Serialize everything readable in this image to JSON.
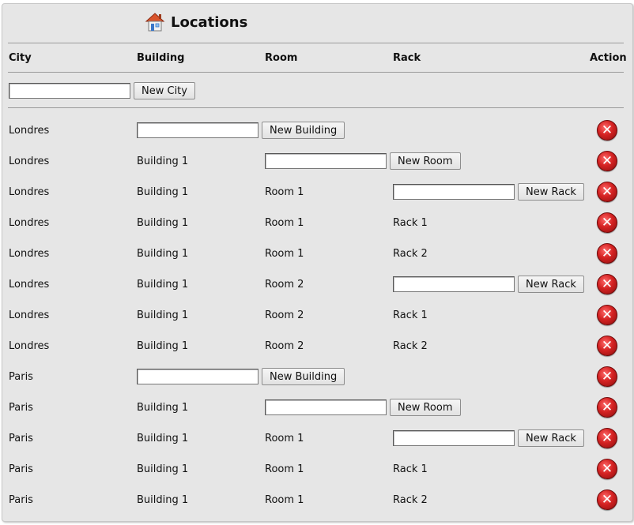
{
  "title": "Locations",
  "columns": {
    "city": "City",
    "building": "Building",
    "room": "Room",
    "rack": "Rack",
    "action": "Action"
  },
  "new_city_button": "New City",
  "delete_glyph": "✕",
  "rows": [
    {
      "city": "Londres",
      "building_btn": "New Building"
    },
    {
      "city": "Londres",
      "building": "Building 1",
      "room_btn": "New Room"
    },
    {
      "city": "Londres",
      "building": "Building 1",
      "room": "Room 1",
      "rack_btn": "New Rack"
    },
    {
      "city": "Londres",
      "building": "Building 1",
      "room": "Room 1",
      "rack": "Rack 1"
    },
    {
      "city": "Londres",
      "building": "Building 1",
      "room": "Room 1",
      "rack": "Rack 2"
    },
    {
      "city": "Londres",
      "building": "Building 1",
      "room": "Room 2",
      "rack_btn": "New Rack"
    },
    {
      "city": "Londres",
      "building": "Building 1",
      "room": "Room 2",
      "rack": "Rack 1"
    },
    {
      "city": "Londres",
      "building": "Building 1",
      "room": "Room 2",
      "rack": "Rack 2"
    },
    {
      "city": "Paris",
      "building_btn": "New Building"
    },
    {
      "city": "Paris",
      "building": "Building 1",
      "room_btn": "New Room"
    },
    {
      "city": "Paris",
      "building": "Building 1",
      "room": "Room 1",
      "rack_btn": "New Rack"
    },
    {
      "city": "Paris",
      "building": "Building 1",
      "room": "Room 1",
      "rack": "Rack 1"
    },
    {
      "city": "Paris",
      "building": "Building 1",
      "room": "Room 1",
      "rack": "Rack 2"
    }
  ]
}
